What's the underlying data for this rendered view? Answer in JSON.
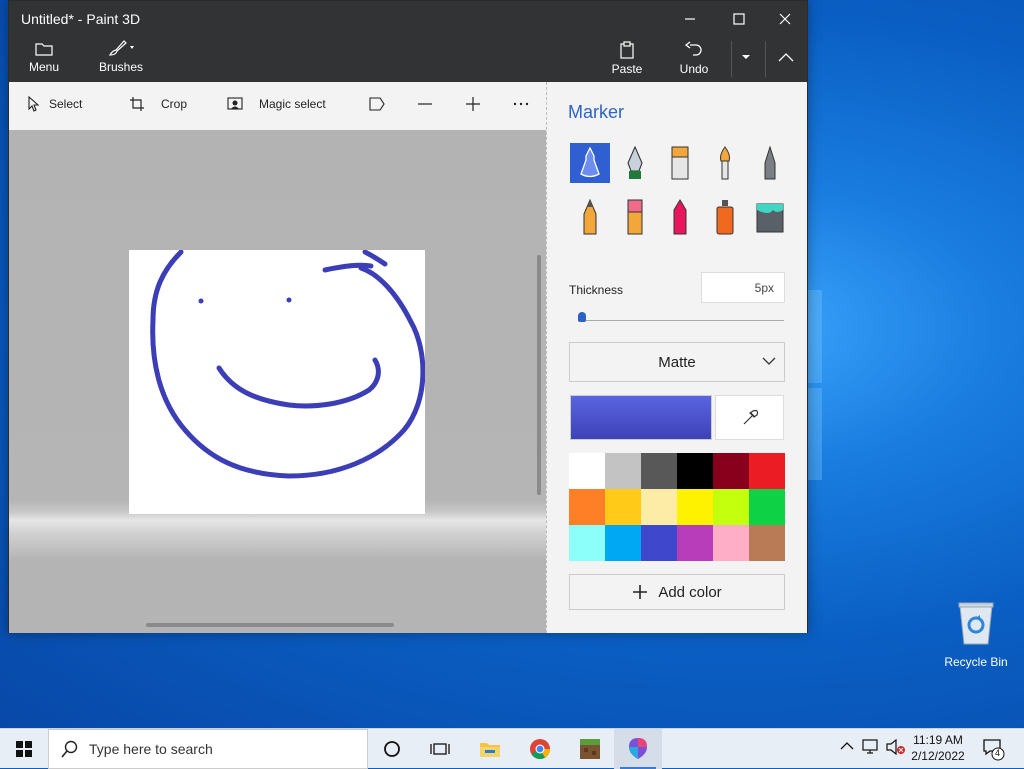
{
  "window": {
    "title": "Untitled* - Paint 3D",
    "ribbon": {
      "menu_label": "Menu",
      "brushes_label": "Brushes",
      "paste_label": "Paste",
      "undo_label": "Undo"
    }
  },
  "toolbar": {
    "select_label": "Select",
    "crop_label": "Crop",
    "magic_select_label": "Magic select"
  },
  "panel": {
    "title": "Marker",
    "brushes": [
      {
        "icon": "marker-icon",
        "selected": true
      },
      {
        "icon": "calligraphy-pen-icon",
        "selected": false
      },
      {
        "icon": "oil-brush-icon",
        "selected": false
      },
      {
        "icon": "watercolor-icon",
        "selected": false
      },
      {
        "icon": "pixel-pen-icon",
        "selected": false
      },
      {
        "icon": "pencil-icon",
        "selected": false
      },
      {
        "icon": "eraser-icon",
        "selected": false
      },
      {
        "icon": "crayon-icon",
        "selected": false
      },
      {
        "icon": "spray-can-icon",
        "selected": false
      },
      {
        "icon": "fill-bucket-icon",
        "selected": false
      }
    ],
    "thickness_label": "Thickness",
    "thickness_value": "5px",
    "thickness_slider_fraction": 0.01,
    "finish_value": "Matte",
    "current_color": "#3d42b8",
    "palette": [
      "#ffffff",
      "#c3c3c3",
      "#585858",
      "#000000",
      "#88001b",
      "#ec1c24",
      "#ff7f27",
      "#ffca18",
      "#fdeca6",
      "#fff200",
      "#c4ff0e",
      "#0ed145",
      "#8cfffb",
      "#00a8f3",
      "#3f48cc",
      "#b83dba",
      "#ffaec8",
      "#b97a56"
    ],
    "add_color_label": "Add color"
  },
  "desktop": {
    "recycle_bin_label": "Recycle Bin"
  },
  "taskbar": {
    "search_placeholder": "Type here to search",
    "time": "11:19 AM",
    "date": "2/12/2022",
    "notification_count": "4",
    "apps": [
      "task-view-icon",
      "file-explorer-icon",
      "chrome-icon",
      "minecraft-icon",
      "paint-3d-icon"
    ]
  }
}
